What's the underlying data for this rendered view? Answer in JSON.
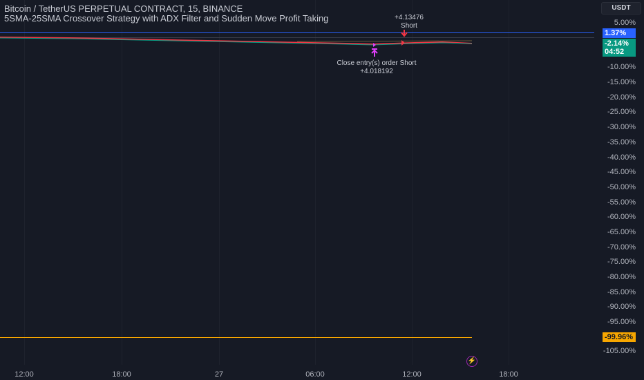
{
  "header": {
    "symbol_line": "Bitcoin / TetherUS PERPETUAL CONTRACT, 15, BINANCE",
    "strategy_line": "5SMA-25SMA Crossover Strategy with ADX Filter and Sudden Move Profit Taking"
  },
  "currency_button": "USDT",
  "price_axis": [
    "5.00%",
    "-10.00%",
    "-15.00%",
    "-20.00%",
    "-25.00%",
    "-30.00%",
    "-35.00%",
    "-40.00%",
    "-45.00%",
    "-50.00%",
    "-55.00%",
    "-60.00%",
    "-65.00%",
    "-70.00%",
    "-75.00%",
    "-80.00%",
    "-85.00%",
    "-90.00%",
    "-95.00%",
    "-105.00%"
  ],
  "time_axis": [
    "12:00",
    "18:00",
    "27",
    "06:00",
    "12:00",
    "18:00"
  ],
  "tags": {
    "blue": "1.37%",
    "green_value": "-2.14%",
    "green_timer": "04:52",
    "orange": "-99.96%"
  },
  "annotations": {
    "short_profit": "+4.13476",
    "short_label": "Short",
    "close_label": "Close entry(s) order Short",
    "close_profit": "+4.018192"
  },
  "colors": {
    "background": "#161a25",
    "blue": "#2962ff",
    "green": "#089981",
    "orange": "#f7a600",
    "red": "#f23645",
    "magenta": "#e040fb"
  }
}
